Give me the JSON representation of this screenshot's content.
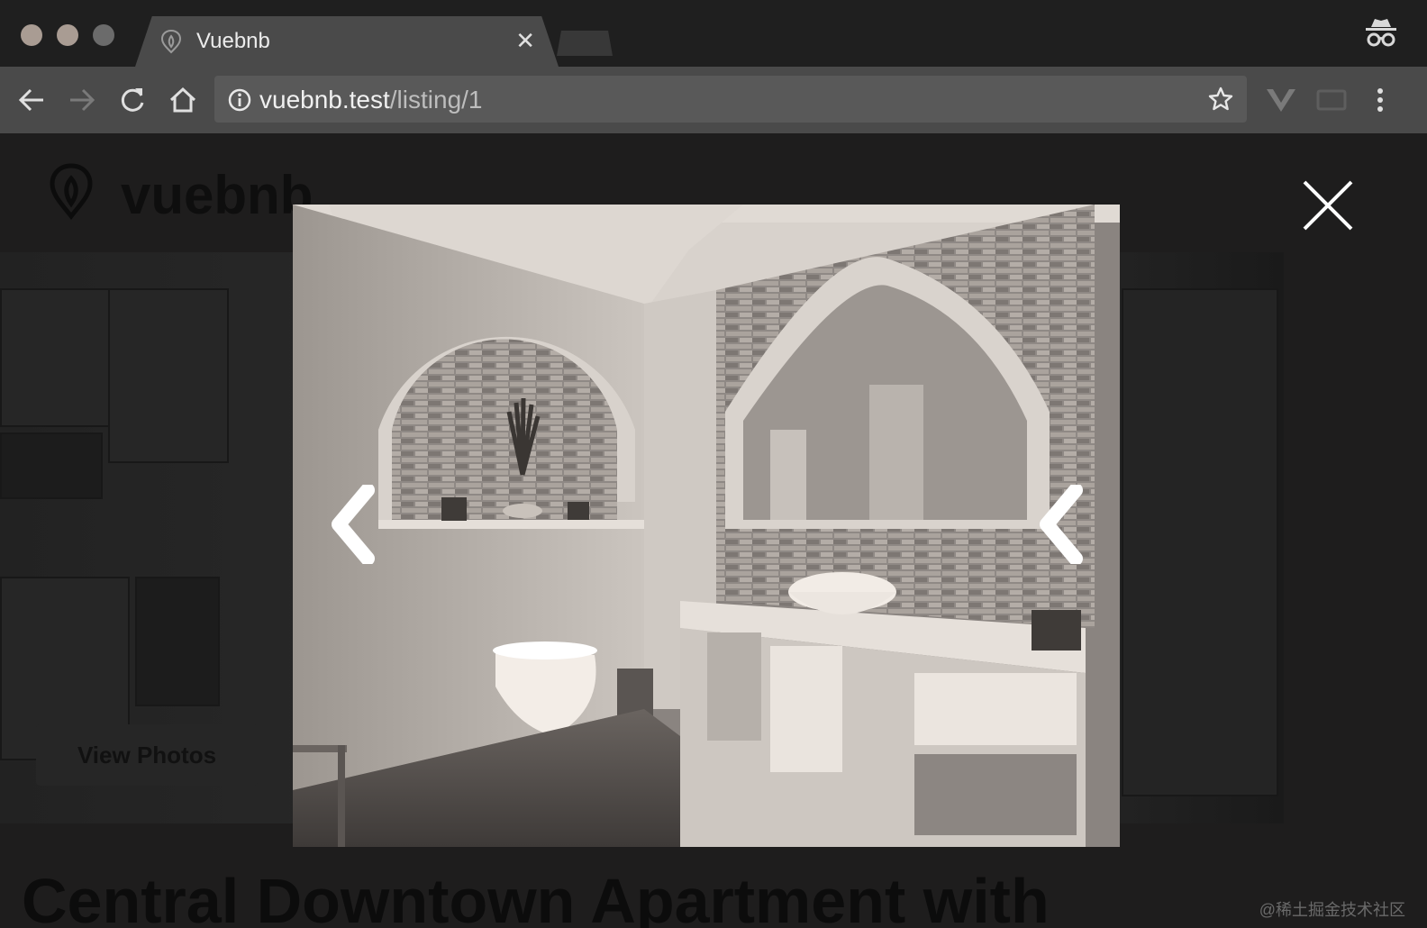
{
  "browser": {
    "tab_title": "Vuebnb",
    "url_host": "vuebnb.test",
    "url_path": "/listing/1"
  },
  "page": {
    "brand": "vuebnb",
    "view_photos_label": "View Photos",
    "listing_title": "Central Downtown Apartment with"
  },
  "watermark": "@稀土掘金技术社区",
  "colors": {
    "chrome_bg": "#1f1f1f",
    "toolbar_bg": "#4a4a4a",
    "overlay_bg": "#1e1d1d"
  },
  "icons": [
    "back-icon",
    "forward-icon",
    "reload-icon",
    "home-icon",
    "info-icon",
    "star-icon",
    "vue-extension-icon",
    "cast-icon",
    "menu-icon",
    "incognito-icon",
    "close-icon",
    "chevron-left-icon",
    "chevron-right-icon"
  ]
}
